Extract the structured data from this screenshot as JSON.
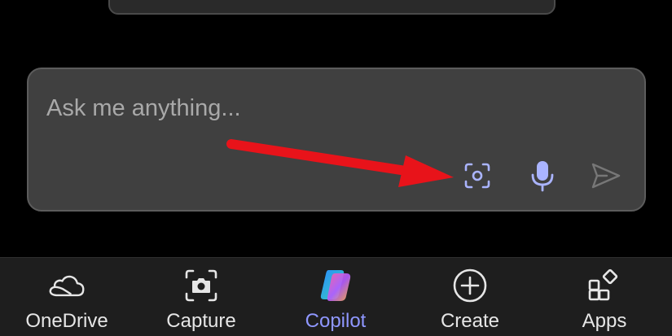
{
  "composer": {
    "placeholder": "Ask me anything..."
  },
  "composer_actions": [
    {
      "name": "camera-capture",
      "icon": "camera-scan-icon"
    },
    {
      "name": "microphone",
      "icon": "microphone-icon"
    },
    {
      "name": "send",
      "icon": "send-icon"
    }
  ],
  "tabs": [
    {
      "label": "OneDrive",
      "icon": "cloud-icon",
      "active": false
    },
    {
      "label": "Capture",
      "icon": "camera-icon",
      "active": false
    },
    {
      "label": "Copilot",
      "icon": "copilot-logo-icon",
      "active": true
    },
    {
      "label": "Create",
      "icon": "plus-circle-icon",
      "active": false
    },
    {
      "label": "Apps",
      "icon": "apps-grid-icon",
      "active": false
    }
  ],
  "colors": {
    "background": "#000000",
    "composer_bg": "#404040",
    "composer_border": "#5c5c5c",
    "accent": "#8f97ff",
    "icon_accent": "#aab4ff",
    "annotation_arrow": "#e8131a",
    "tabbar_bg": "#1e1e1e"
  }
}
